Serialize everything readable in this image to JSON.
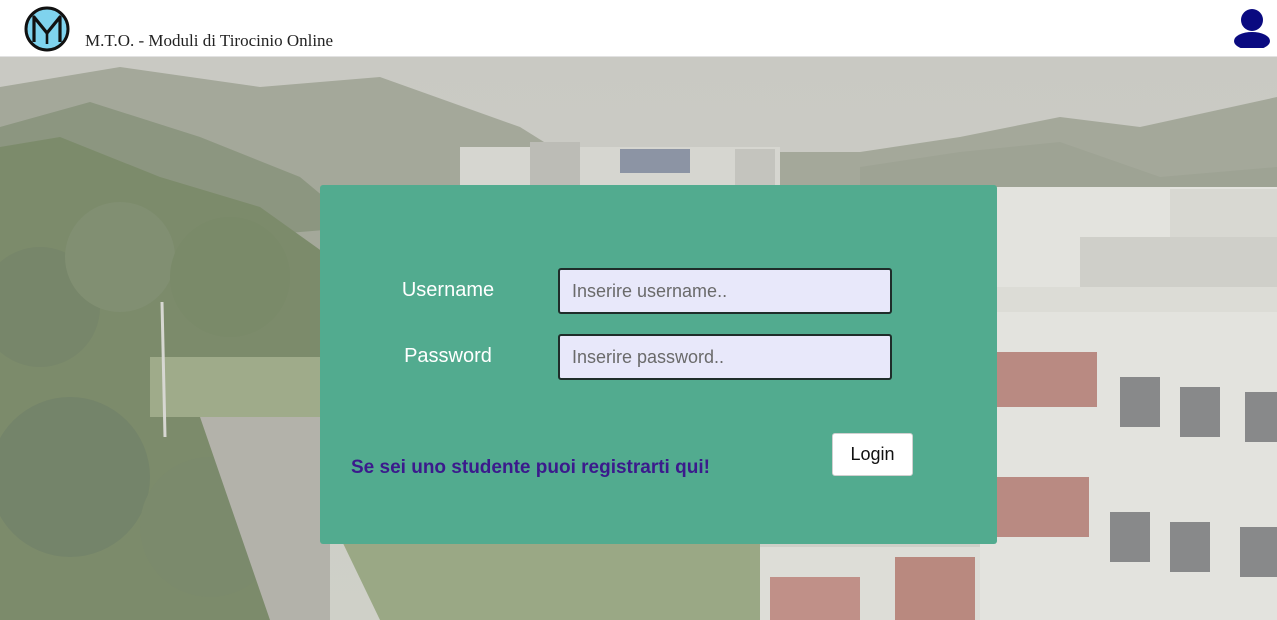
{
  "header": {
    "app_title": "M.T.O. - Moduli di Tirocinio Online",
    "logo_icon": "mto-logo-icon",
    "user_icon": "user-account-icon"
  },
  "login": {
    "username_label": "Username",
    "username_placeholder": "Inserire username..",
    "username_value": "",
    "password_label": "Password",
    "password_placeholder": "Inserire password..",
    "password_value": "",
    "login_button": "Login",
    "register_link": "Se sei uno studente puoi registrarti qui!"
  },
  "colors": {
    "card_background": "#52ab8f",
    "input_background": "#e8e8fa",
    "register_link": "#3b1a8c",
    "user_icon": "#0a0a80"
  }
}
